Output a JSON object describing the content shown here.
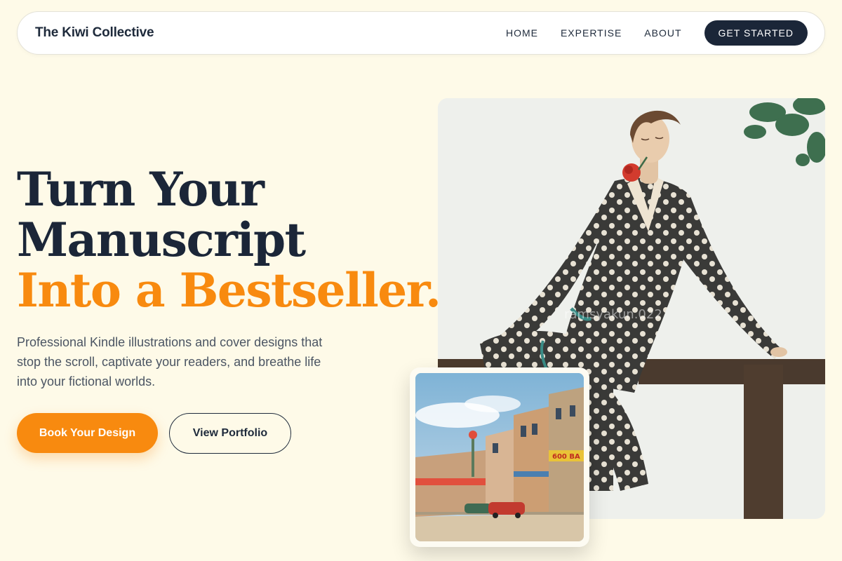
{
  "nav": {
    "brand": "The Kiwi Collective",
    "links": [
      "HOME",
      "EXPERTISE",
      "ABOUT"
    ],
    "cta": "GET STARTED"
  },
  "hero": {
    "headline_line1": "Turn Your",
    "headline_line2": "Manuscript",
    "headline_accent": "Into a Bestseller.",
    "subtext": "Professional Kindle illustrations and cover designs that stop the scroll, captivate your readers, and breathe life into your fictional worlds.",
    "primary_button": "Book Your Design",
    "secondary_button": "View Portfolio"
  },
  "images": {
    "main": "vintage-woman-polka-dot-illustration",
    "inset": "vintage-street-postcard",
    "watermark": "ramsyakun.022",
    "storefront_sign": "600 BA"
  },
  "colors": {
    "background": "#fefae8",
    "navy": "#1b2638",
    "accent_orange": "#f88a0f",
    "body_text": "#4b5563"
  }
}
